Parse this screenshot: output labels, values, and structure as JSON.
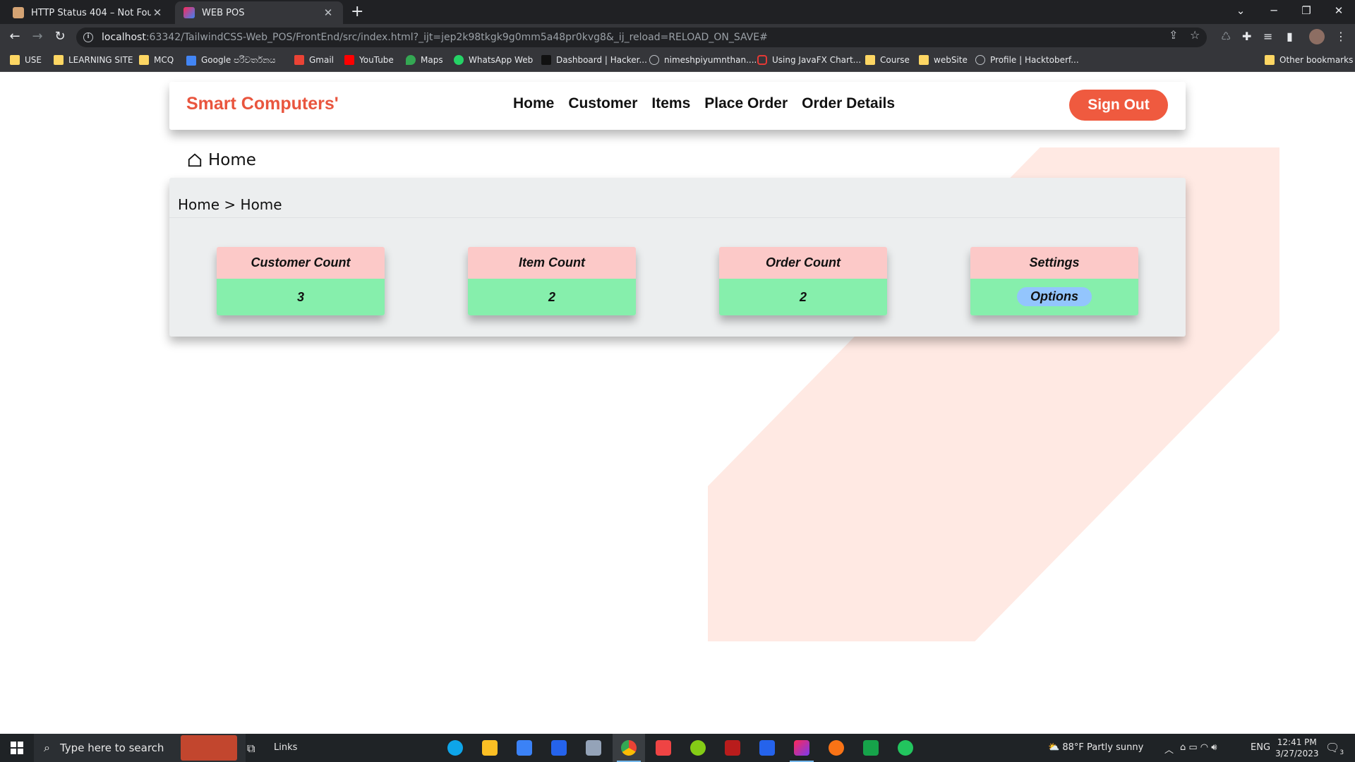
{
  "browser": {
    "tabs": [
      {
        "title": "HTTP Status 404 – Not Found",
        "close": "✕"
      },
      {
        "title": "WEB POS",
        "close": "✕"
      }
    ],
    "new_tab": "+",
    "window_controls": [
      "─",
      "❐",
      "✕"
    ],
    "url_host": "localhost",
    "url_rest": ":63342/TailwindCSS-Web_POS/FrontEnd/src/index.html?_ijt=jep2k98tkgk9g0mm5a48pr0kvg8&_ij_reload=RELOAD_ON_SAVE#",
    "bookmarks": [
      "USE",
      "LEARNING SITE",
      "MCQ",
      "Google පරිවර්තනය",
      "Gmail",
      "YouTube",
      "Maps",
      "WhatsApp Web",
      "Dashboard | Hacker...",
      "nimeshpiyumnthan....",
      "Using JavaFX Chart...",
      "Course",
      "webSite",
      "Profile | Hacktoberf..."
    ],
    "other_bookmarks": "Other bookmarks"
  },
  "navbar": {
    "brand": "Smart Computers'",
    "links": [
      "Home",
      "Customer",
      "Items",
      "Place Order",
      "Order Details"
    ],
    "signout_label": "Sign Out"
  },
  "page": {
    "heading": "Home",
    "breadcrumb": "Home > Home"
  },
  "cards": [
    {
      "title": "Customer Count",
      "value": "3"
    },
    {
      "title": "Item Count",
      "value": "2"
    },
    {
      "title": "Order Count",
      "value": "2"
    },
    {
      "title": "Settings",
      "button": "Options"
    }
  ],
  "taskbar": {
    "search_placeholder": "Type here to search",
    "links_label": "Links",
    "weather": "88°F  Partly sunny",
    "language": "ENG",
    "time": "12:41 PM",
    "date": "3/27/2023",
    "notification_count": "3"
  },
  "colors": {
    "brand": "#e9553e",
    "signout": "#ef5a3f",
    "card_header": "#fcc9c8",
    "card_body": "#86efac",
    "options_button": "#93c5fd",
    "decoration": "#ffe9e3"
  }
}
